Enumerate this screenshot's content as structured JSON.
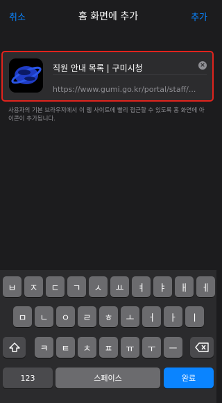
{
  "header": {
    "cancel_label": "취소",
    "title": "홈 화면에 추가",
    "add_label": "추가"
  },
  "card": {
    "title": "직원 안내 목록 | 구미시청",
    "url": "https://www.gumi.go.kr/portal/staff/...",
    "icon_name": "gumi-city-app-icon",
    "clear_icon": "×"
  },
  "caption": "사용자의 기본 브라우저에서 이 웹 사이트에 빨리 접근할 수 있도록 홈 화면에 아이콘이 추가됩니다.",
  "keyboard": {
    "row1": [
      "ㅂ",
      "ㅈ",
      "ㄷ",
      "ㄱ",
      "ㅅ",
      "ㅛ",
      "ㅕ",
      "ㅑ",
      "ㅐ",
      "ㅔ"
    ],
    "row2": [
      "ㅁ",
      "ㄴ",
      "ㅇ",
      "ㄹ",
      "ㅎ",
      "ㅗ",
      "ㅓ",
      "ㅏ",
      "ㅣ"
    ],
    "row3": [
      "ㅋ",
      "ㅌ",
      "ㅊ",
      "ㅍ",
      "ㅠ",
      "ㅜ",
      "ㅡ"
    ],
    "shift_icon": "shift-arrow",
    "delete_icon": "delete-backspace",
    "numbers_label": "123",
    "space_label": "스페이스",
    "done_label": "완료"
  },
  "colors": {
    "accent": "#0a84ff",
    "highlight_border": "#e0231d",
    "background": "#1c1c1e"
  }
}
